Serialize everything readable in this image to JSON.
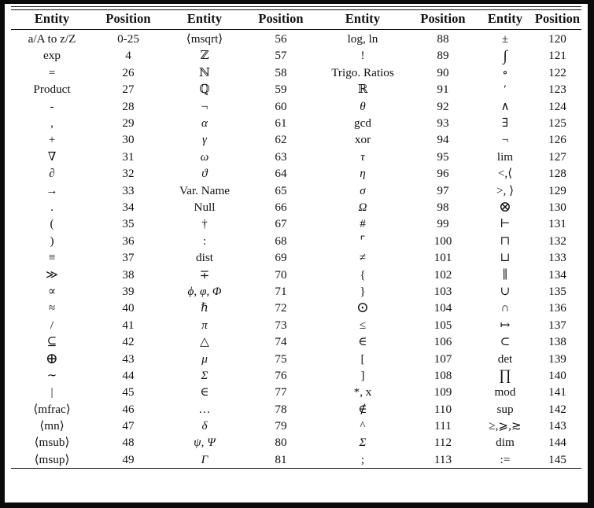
{
  "table": {
    "headers": [
      "Entity",
      "Position",
      "Entity",
      "Position",
      "Entity",
      "Position",
      "Entity",
      "Position"
    ],
    "rows": [
      [
        "a/A to z/Z",
        "0-25",
        "⟨msqrt⟩",
        "56",
        "log, ln",
        "88",
        "±",
        "120"
      ],
      [
        "exp",
        "4",
        "ℤ",
        "57",
        "!",
        "89",
        "∫",
        "121"
      ],
      [
        "=",
        "26",
        "ℕ",
        "58",
        "Trigo. Ratios",
        "90",
        "∘",
        "122"
      ],
      [
        "Product",
        "27",
        "ℚ",
        "59",
        "ℝ",
        "91",
        "′",
        "123"
      ],
      [
        "-",
        "28",
        "¬",
        "60",
        "θ",
        "92",
        "∧",
        "124"
      ],
      [
        ",",
        "29",
        "α",
        "61",
        "gcd",
        "93",
        "∃",
        "125"
      ],
      [
        "+",
        "30",
        "γ",
        "62",
        "xor",
        "94",
        "¬",
        "126"
      ],
      [
        "∇",
        "31",
        "ω",
        "63",
        "τ",
        "95",
        "lim",
        "127"
      ],
      [
        "∂",
        "32",
        "ϑ",
        "64",
        "η",
        "96",
        "<,⟨",
        "128"
      ],
      [
        "→",
        "33",
        "Var. Name",
        "65",
        "σ",
        "97",
        ">, ⟩",
        "129"
      ],
      [
        ".",
        "34",
        "Null",
        "66",
        "Ω",
        "98",
        "⊗",
        "130"
      ],
      [
        "(",
        "35",
        "†",
        "67",
        "#",
        "99",
        "⊢",
        "131"
      ],
      [
        ")",
        "36",
        ":",
        "68",
        "⌜",
        "100",
        "⊓",
        "132"
      ],
      [
        "≡",
        "37",
        "dist",
        "69",
        "≠",
        "101",
        "⊔",
        "133"
      ],
      [
        "≫",
        "38",
        "∓",
        "70",
        "{",
        "102",
        "∥",
        "134"
      ],
      [
        "∝",
        "39",
        "ϕ, φ, Φ",
        "71",
        "}",
        "103",
        "∪",
        "135"
      ],
      [
        "≈",
        "40",
        "ℏ",
        "72",
        "⊙",
        "104",
        "∩",
        "136"
      ],
      [
        "/",
        "41",
        "π",
        "73",
        "≤",
        "105",
        "↦",
        "137"
      ],
      [
        "⊆",
        "42",
        "△",
        "74",
        "∈",
        "106",
        "⊂",
        "138"
      ],
      [
        "⊕",
        "43",
        "μ",
        "75",
        "[",
        "107",
        "det",
        "139"
      ],
      [
        "∼",
        "44",
        "Σ",
        "76",
        "]",
        "108",
        "∏",
        "140"
      ],
      [
        "|",
        "45",
        "∈",
        "77",
        "*, x",
        "109",
        "mod",
        "141"
      ],
      [
        "⟨mfrac⟩",
        "46",
        "…",
        "78",
        "∉",
        "110",
        "sup",
        "142"
      ],
      [
        "⟨mn⟩",
        "47",
        "δ",
        "79",
        "^",
        "111",
        "≥,⩾,≳",
        "143"
      ],
      [
        "⟨msub⟩",
        "48",
        "ψ, Ψ",
        "80",
        "Σ",
        "112",
        "dim",
        "144"
      ],
      [
        "⟨msup⟩",
        "49",
        "Γ",
        "81",
        ";",
        "113",
        ":=",
        "145"
      ]
    ]
  },
  "style": {
    "frame_color": "#0b0b0b",
    "text_color": "#111111",
    "background": "#ffffff"
  }
}
